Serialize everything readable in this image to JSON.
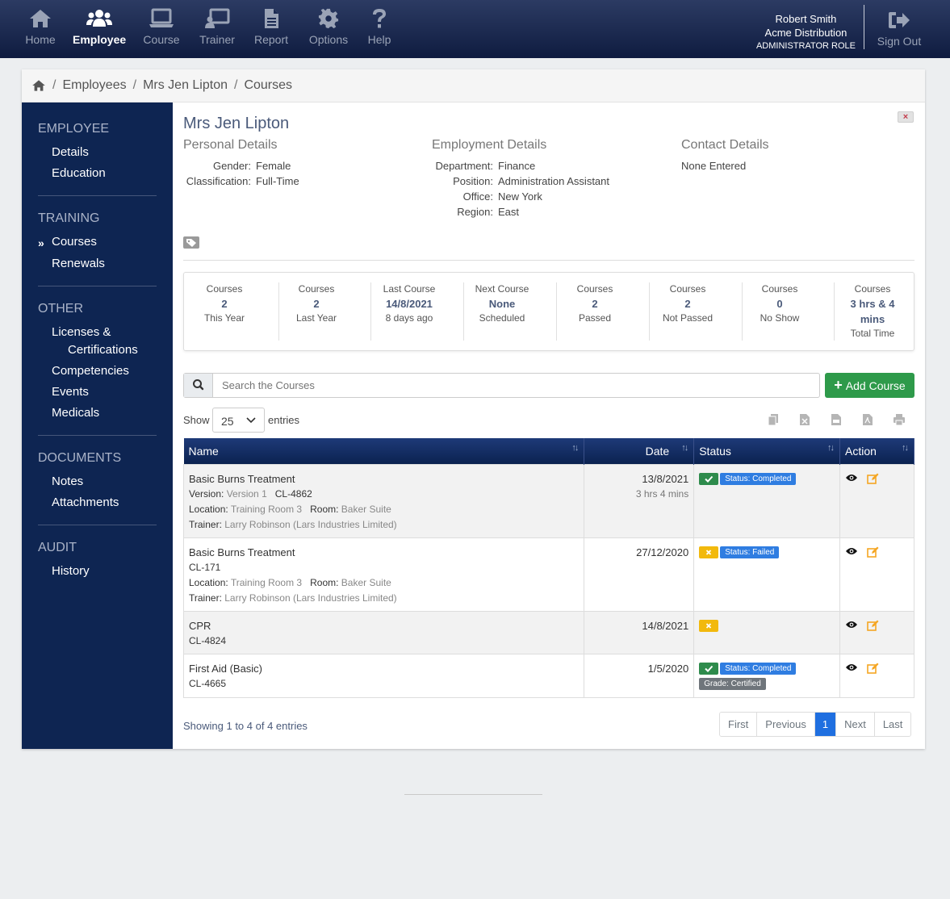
{
  "nav": {
    "items": [
      {
        "label": "Home",
        "icon": "home-icon"
      },
      {
        "label": "Employee",
        "icon": "users-icon",
        "active": true
      },
      {
        "label": "Course",
        "icon": "laptop-icon"
      },
      {
        "label": "Trainer",
        "icon": "trainer-icon"
      },
      {
        "label": "Report",
        "icon": "report-icon"
      },
      {
        "label": "Options",
        "icon": "gear-icon"
      },
      {
        "label": "Help",
        "icon": "question-icon"
      }
    ],
    "user_name": "Robert Smith",
    "company": "Acme Distribution",
    "role": "ADMINISTRATOR ROLE",
    "signout_label": "Sign Out"
  },
  "breadcrumb": {
    "items": [
      "Employees",
      "Mrs Jen Lipton",
      "Courses"
    ],
    "separator": "/"
  },
  "sidebar": {
    "sections": [
      {
        "heading": "EMPLOYEE",
        "items": [
          "Details",
          "Education"
        ]
      },
      {
        "heading": "TRAINING",
        "items": [
          "Courses",
          "Renewals"
        ],
        "active": "Courses"
      },
      {
        "heading": "OTHER",
        "items": [
          "Licenses &",
          "Certifications",
          "Competencies",
          "Events",
          "Medicals"
        ]
      },
      {
        "heading": "DOCUMENTS",
        "items": [
          "Notes",
          "Attachments"
        ]
      },
      {
        "heading": "AUDIT",
        "items": [
          "History"
        ]
      }
    ],
    "active_marker": "»"
  },
  "employee": {
    "name": "Mrs Jen Lipton",
    "close_label": "×",
    "personal": {
      "title": "Personal Details",
      "fields": [
        {
          "k": "Gender:",
          "v": "Female"
        },
        {
          "k": "Classification:",
          "v": "Full-Time"
        }
      ]
    },
    "employment": {
      "title": "Employment Details",
      "fields": [
        {
          "k": "Department:",
          "v": "Finance"
        },
        {
          "k": "Position:",
          "v": "Administration Assistant"
        },
        {
          "k": "Office:",
          "v": "New York"
        },
        {
          "k": "Region:",
          "v": "East"
        }
      ]
    },
    "contact": {
      "title": "Contact Details",
      "text": "None Entered"
    }
  },
  "stats": [
    {
      "top": "Courses",
      "val": "2",
      "bottom": "This Year"
    },
    {
      "top": "Courses",
      "val": "2",
      "bottom": "Last Year"
    },
    {
      "top": "Last Course",
      "val": "14/8/2021",
      "bottom": "8 days ago"
    },
    {
      "top": "Next Course",
      "val": "None",
      "bottom": "Scheduled"
    },
    {
      "top": "Courses",
      "val": "2",
      "bottom": "Passed"
    },
    {
      "top": "Courses",
      "val": "2",
      "bottom": "Not Passed"
    },
    {
      "top": "Courses",
      "val": "0",
      "bottom": "No Show"
    },
    {
      "top": "Courses",
      "val1": "3 hrs & 4",
      "val2": "mins",
      "bottom": "Total Time"
    }
  ],
  "search": {
    "placeholder": "Search the Courses",
    "value": ""
  },
  "add_course_label": "Add Course",
  "length": {
    "show": "Show",
    "value": "25",
    "entries": "entries"
  },
  "export_icons": [
    "copy-icon",
    "excel-icon",
    "csv-icon",
    "pdf-icon",
    "print-icon"
  ],
  "table": {
    "headers": [
      "Name",
      "Date",
      "Status",
      "Action"
    ],
    "rows": [
      {
        "name": "Basic Burns Treatment",
        "version_label": "Version:",
        "version": "Version 1",
        "code": "CL-4862",
        "location_label": "Location:",
        "location": "Training Room 3",
        "room_label": "Room:",
        "room": "Baker Suite",
        "trainer_label": "Trainer:",
        "trainer": "Larry Robinson (Lars Industries Limited)",
        "date": "13/8/2021",
        "duration": "3 hrs 4 mins",
        "result": "passed",
        "status": "Status: Completed"
      },
      {
        "name": "Basic Burns Treatment",
        "code": "CL-171",
        "location_label": "Location:",
        "location": "Training Room 3",
        "room_label": "Room:",
        "room": "Baker Suite",
        "trainer_label": "Trainer:",
        "trainer": "Larry Robinson (Lars Industries Limited)",
        "date": "27/12/2020",
        "result": "failed",
        "status": "Status: Failed"
      },
      {
        "name": "CPR",
        "code": "CL-4824",
        "date": "14/8/2021",
        "result": "failed"
      },
      {
        "name": "First Aid (Basic)",
        "code": "CL-4665",
        "date": "1/5/2020",
        "result": "passed",
        "status": "Status: Completed",
        "grade": "Grade: Certified"
      }
    ]
  },
  "footer": {
    "showing": "Showing 1 to 4 of 4 entries",
    "pages": [
      "First",
      "Previous",
      "1",
      "Next",
      "Last"
    ],
    "current_page": "1"
  },
  "colors": {
    "nav_bg": "#0f1c40",
    "sidebar_bg": "#0e2552",
    "accent_blue": "#1f6fe0",
    "success": "#2e9a4a",
    "warning": "#f2b90d"
  }
}
